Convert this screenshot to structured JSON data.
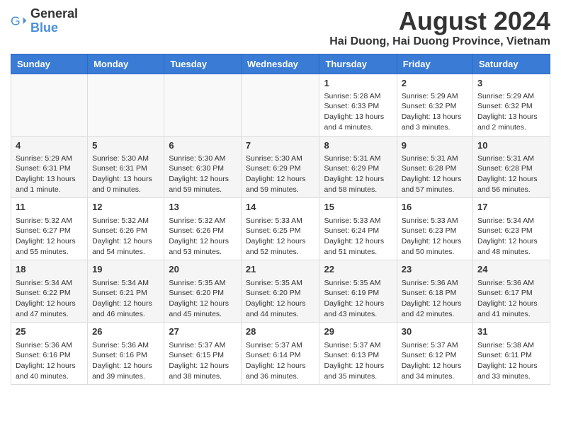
{
  "logo": {
    "text_general": "General",
    "text_blue": "Blue"
  },
  "title": {
    "month_year": "August 2024",
    "location": "Hai Duong, Hai Duong Province, Vietnam"
  },
  "days_of_week": [
    "Sunday",
    "Monday",
    "Tuesday",
    "Wednesday",
    "Thursday",
    "Friday",
    "Saturday"
  ],
  "weeks": [
    [
      {
        "day": "",
        "content": ""
      },
      {
        "day": "",
        "content": ""
      },
      {
        "day": "",
        "content": ""
      },
      {
        "day": "",
        "content": ""
      },
      {
        "day": "1",
        "content": "Sunrise: 5:28 AM\nSunset: 6:33 PM\nDaylight: 13 hours and 4 minutes."
      },
      {
        "day": "2",
        "content": "Sunrise: 5:29 AM\nSunset: 6:32 PM\nDaylight: 13 hours and 3 minutes."
      },
      {
        "day": "3",
        "content": "Sunrise: 5:29 AM\nSunset: 6:32 PM\nDaylight: 13 hours and 2 minutes."
      }
    ],
    [
      {
        "day": "4",
        "content": "Sunrise: 5:29 AM\nSunset: 6:31 PM\nDaylight: 13 hours and 1 minute."
      },
      {
        "day": "5",
        "content": "Sunrise: 5:30 AM\nSunset: 6:31 PM\nDaylight: 13 hours and 0 minutes."
      },
      {
        "day": "6",
        "content": "Sunrise: 5:30 AM\nSunset: 6:30 PM\nDaylight: 12 hours and 59 minutes."
      },
      {
        "day": "7",
        "content": "Sunrise: 5:30 AM\nSunset: 6:29 PM\nDaylight: 12 hours and 59 minutes."
      },
      {
        "day": "8",
        "content": "Sunrise: 5:31 AM\nSunset: 6:29 PM\nDaylight: 12 hours and 58 minutes."
      },
      {
        "day": "9",
        "content": "Sunrise: 5:31 AM\nSunset: 6:28 PM\nDaylight: 12 hours and 57 minutes."
      },
      {
        "day": "10",
        "content": "Sunrise: 5:31 AM\nSunset: 6:28 PM\nDaylight: 12 hours and 56 minutes."
      }
    ],
    [
      {
        "day": "11",
        "content": "Sunrise: 5:32 AM\nSunset: 6:27 PM\nDaylight: 12 hours and 55 minutes."
      },
      {
        "day": "12",
        "content": "Sunrise: 5:32 AM\nSunset: 6:26 PM\nDaylight: 12 hours and 54 minutes."
      },
      {
        "day": "13",
        "content": "Sunrise: 5:32 AM\nSunset: 6:26 PM\nDaylight: 12 hours and 53 minutes."
      },
      {
        "day": "14",
        "content": "Sunrise: 5:33 AM\nSunset: 6:25 PM\nDaylight: 12 hours and 52 minutes."
      },
      {
        "day": "15",
        "content": "Sunrise: 5:33 AM\nSunset: 6:24 PM\nDaylight: 12 hours and 51 minutes."
      },
      {
        "day": "16",
        "content": "Sunrise: 5:33 AM\nSunset: 6:23 PM\nDaylight: 12 hours and 50 minutes."
      },
      {
        "day": "17",
        "content": "Sunrise: 5:34 AM\nSunset: 6:23 PM\nDaylight: 12 hours and 48 minutes."
      }
    ],
    [
      {
        "day": "18",
        "content": "Sunrise: 5:34 AM\nSunset: 6:22 PM\nDaylight: 12 hours and 47 minutes."
      },
      {
        "day": "19",
        "content": "Sunrise: 5:34 AM\nSunset: 6:21 PM\nDaylight: 12 hours and 46 minutes."
      },
      {
        "day": "20",
        "content": "Sunrise: 5:35 AM\nSunset: 6:20 PM\nDaylight: 12 hours and 45 minutes."
      },
      {
        "day": "21",
        "content": "Sunrise: 5:35 AM\nSunset: 6:20 PM\nDaylight: 12 hours and 44 minutes."
      },
      {
        "day": "22",
        "content": "Sunrise: 5:35 AM\nSunset: 6:19 PM\nDaylight: 12 hours and 43 minutes."
      },
      {
        "day": "23",
        "content": "Sunrise: 5:36 AM\nSunset: 6:18 PM\nDaylight: 12 hours and 42 minutes."
      },
      {
        "day": "24",
        "content": "Sunrise: 5:36 AM\nSunset: 6:17 PM\nDaylight: 12 hours and 41 minutes."
      }
    ],
    [
      {
        "day": "25",
        "content": "Sunrise: 5:36 AM\nSunset: 6:16 PM\nDaylight: 12 hours and 40 minutes."
      },
      {
        "day": "26",
        "content": "Sunrise: 5:36 AM\nSunset: 6:16 PM\nDaylight: 12 hours and 39 minutes."
      },
      {
        "day": "27",
        "content": "Sunrise: 5:37 AM\nSunset: 6:15 PM\nDaylight: 12 hours and 38 minutes."
      },
      {
        "day": "28",
        "content": "Sunrise: 5:37 AM\nSunset: 6:14 PM\nDaylight: 12 hours and 36 minutes."
      },
      {
        "day": "29",
        "content": "Sunrise: 5:37 AM\nSunset: 6:13 PM\nDaylight: 12 hours and 35 minutes."
      },
      {
        "day": "30",
        "content": "Sunrise: 5:37 AM\nSunset: 6:12 PM\nDaylight: 12 hours and 34 minutes."
      },
      {
        "day": "31",
        "content": "Sunrise: 5:38 AM\nSunset: 6:11 PM\nDaylight: 12 hours and 33 minutes."
      }
    ]
  ]
}
